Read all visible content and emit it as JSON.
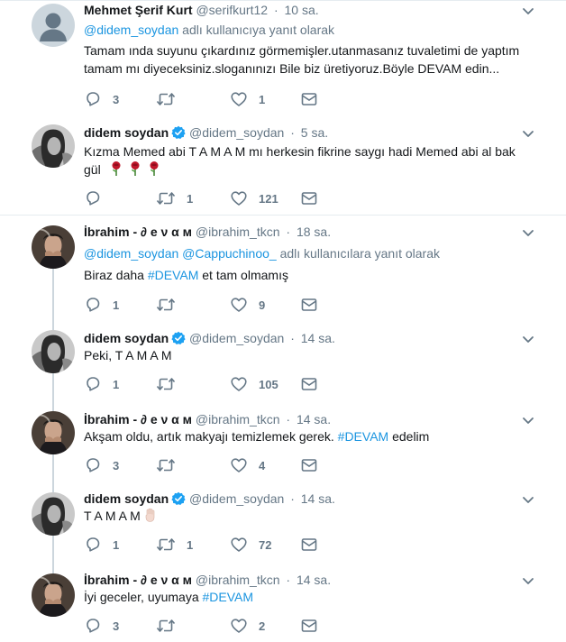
{
  "tweets": [
    {
      "name": "Mehmet Şerif Kurt",
      "handle": "@serifkurt12",
      "time": "10 sa.",
      "reply_mention": "@didem_soydan",
      "reply_suffix": "adlı kullanıcıya yanıt olarak",
      "text_line1": "Tamam ında suyunu çıkardınız görmemişler.utanmasanız tuvaletimi de yaptım",
      "text_line2": "tamam mı diyeceksiniz.sloganınızı  Bile biz üretiyoruz.Böyle DEVAM edin...",
      "replies": "3",
      "retweets": "",
      "likes": "1"
    },
    {
      "name": "didem soydan",
      "handle": "@didem_soydan",
      "time": "5 sa.",
      "text_line1": "Kızma Memed abi T A M A M  mı herkesin fikrine saygı hadi Memed abi al bak",
      "text_line2": "gül",
      "replies": "",
      "retweets": "1",
      "likes": "121"
    },
    {
      "name": "İbrahim - ∂ e ν α м",
      "handle": "@ibrahim_tkcn",
      "time": "18 sa.",
      "reply_mention1": "@didem_soydan",
      "reply_mention2": "@Cappuchinoo_",
      "reply_suffix": "adlı kullanıcılara yanıt olarak",
      "text_before": "Biraz daha ",
      "hashtag": "#DEVAM",
      "text_after": " et tam olmamış",
      "replies": "1",
      "retweets": "",
      "likes": "9"
    },
    {
      "name": "didem soydan",
      "handle": "@didem_soydan",
      "time": "14 sa.",
      "text": "Peki, T A M A M",
      "replies": "1",
      "retweets": "",
      "likes": "105"
    },
    {
      "name": "İbrahim - ∂ e ν α м",
      "handle": "@ibrahim_tkcn",
      "time": "14 sa.",
      "text_before": "Akşam oldu, artık makyajı temizlemek gerek. ",
      "hashtag": "#DEVAM",
      "text_after": " edelim",
      "replies": "3",
      "retweets": "",
      "likes": "4"
    },
    {
      "name": "didem soydan",
      "handle": "@didem_soydan",
      "time": "14 sa.",
      "text": "T A M A M",
      "replies": "1",
      "retweets": "1",
      "likes": "72"
    },
    {
      "name": "İbrahim - ∂ e ν α м",
      "handle": "@ibrahim_tkcn",
      "time": "14 sa.",
      "text_before": "İyi geceler, uyumaya ",
      "hashtag": "#DEVAM",
      "text_after": "",
      "replies": "3",
      "retweets": "",
      "likes": "2"
    }
  ],
  "icons": [
    "reply-icon",
    "retweet-icon",
    "like-icon",
    "direct-message-icon",
    "verified-badge-icon",
    "caret-down-icon",
    "rose-emoji-icon",
    "raised-hand-emoji-icon"
  ],
  "colors": {
    "text": "#14171a",
    "muted": "#657786",
    "link": "#1b95e0",
    "verified": "#1da1f2",
    "divider": "#e6ecf0",
    "thread_line": "#ccd6dd"
  }
}
